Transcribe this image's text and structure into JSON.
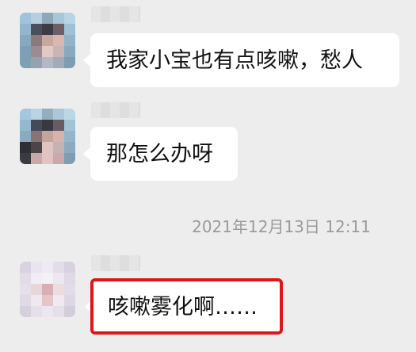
{
  "messages": [
    {
      "text": "我家小宝也有点咳嗽，愁人"
    },
    {
      "text": "那怎么办呀"
    },
    {
      "text": "咳嗽雾化啊……"
    }
  ],
  "timestamp": "2021年12月13日 12:11",
  "highlight_color": "#e01616"
}
